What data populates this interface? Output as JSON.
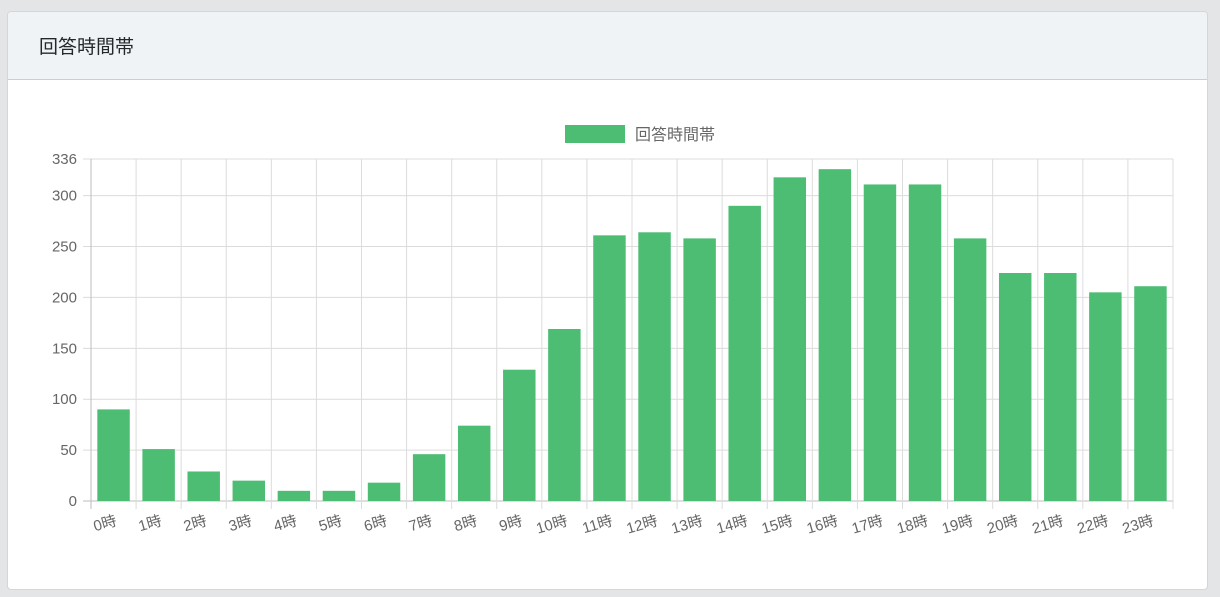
{
  "card": {
    "title": "回答時間帯"
  },
  "colors": {
    "bar_fill": "#4dbd74",
    "grid": "#dcdcdc",
    "axis_text": "#666666",
    "header_bg": "#f0f3f5"
  },
  "chart_data": {
    "type": "bar",
    "title": "",
    "xlabel": "",
    "ylabel": "",
    "categories": [
      "0時",
      "1時",
      "2時",
      "3時",
      "4時",
      "5時",
      "6時",
      "7時",
      "8時",
      "9時",
      "10時",
      "11時",
      "12時",
      "13時",
      "14時",
      "15時",
      "16時",
      "17時",
      "18時",
      "19時",
      "20時",
      "21時",
      "22時",
      "23時"
    ],
    "series": [
      {
        "name": "回答時間帯",
        "color": "#4dbd74",
        "values": [
          90,
          51,
          29,
          20,
          10,
          10,
          18,
          46,
          74,
          129,
          169,
          261,
          264,
          258,
          290,
          318,
          326,
          311,
          311,
          258,
          224,
          224,
          205,
          211
        ]
      }
    ],
    "ylim": [
      0,
      336
    ],
    "yticks": [
      0,
      50,
      100,
      150,
      200,
      250,
      300,
      336
    ],
    "grid": true,
    "legend_position": "top-center"
  }
}
